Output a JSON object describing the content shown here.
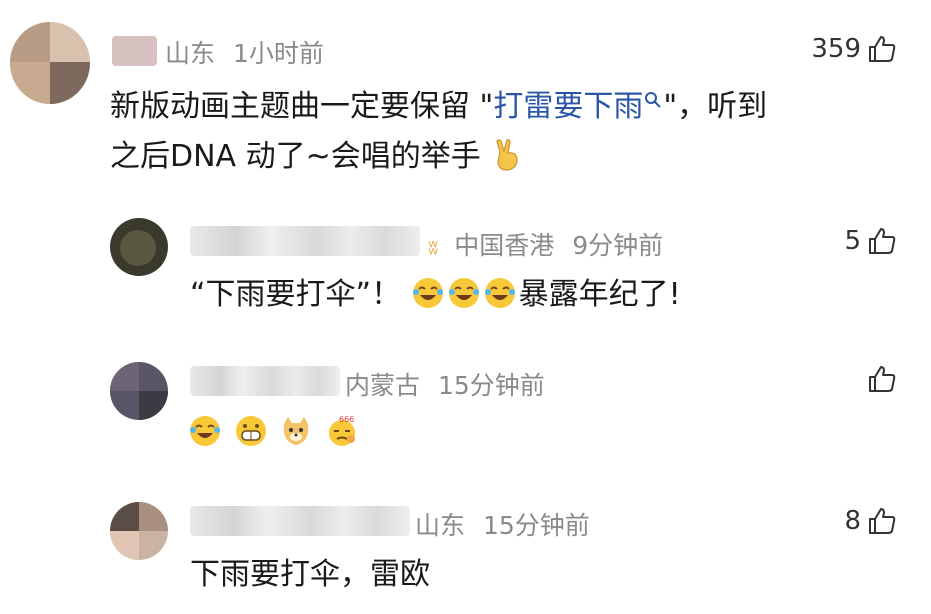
{
  "comments": [
    {
      "location": "山东",
      "time": "1小时前",
      "likes": "359",
      "text_line1_pre": "新版动画主题曲一定要保留 \"",
      "text_link": "打雷要下雨",
      "text_line1_post": "\"，听到",
      "text_line2_pre": "之后DNA 动了~会唱的举手",
      "emoji_names": [
        "victory-hand-emoji"
      ]
    },
    {
      "location": "中国香港",
      "time": "9分钟前",
      "likes": "5",
      "badge": "ʬ",
      "text_pre": "“下雨要打伞”！",
      "text_post": "暴露年纪了!",
      "emoji_names": [
        "laugh-cry-emoji",
        "laugh-cry-emoji",
        "laugh-cry-emoji"
      ]
    },
    {
      "location": "内蒙古",
      "time": "15分钟前",
      "likes": "",
      "emoji_names": [
        "laugh-cry-emoji",
        "grin-emoji",
        "doge-emoji",
        "666-emoji"
      ]
    },
    {
      "location": "山东",
      "time": "15分钟前",
      "likes": "8",
      "text": "下雨要打伞，雷欧"
    }
  ],
  "colors": {
    "link": "#2b56a8",
    "meta": "#8a8a8a",
    "text": "#1a1a1a"
  },
  "icons": {
    "like": "thumbs-up-icon",
    "search": "search-icon"
  }
}
